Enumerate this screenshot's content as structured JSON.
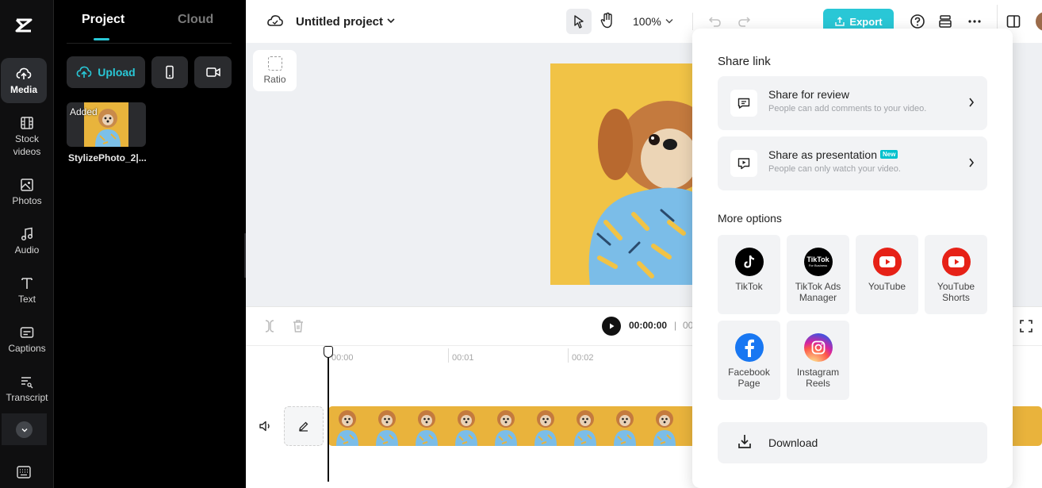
{
  "rail": {
    "items": [
      {
        "label": "Media",
        "icon": "cloud-upload-icon"
      },
      {
        "label": "Stock\nvideos",
        "icon": "film-icon"
      },
      {
        "label": "Photos",
        "icon": "image-icon"
      },
      {
        "label": "Audio",
        "icon": "music-icon"
      },
      {
        "label": "Text",
        "icon": "text-icon"
      },
      {
        "label": "Captions",
        "icon": "captions-icon"
      },
      {
        "label": "Transcript",
        "icon": "transcript-icon"
      }
    ]
  },
  "panel": {
    "tabs": [
      "Project",
      "Cloud"
    ],
    "upload_label": "Upload",
    "media": {
      "badge": "Added",
      "name": "StylizePhoto_2|..."
    }
  },
  "topbar": {
    "project_name": "Untitled project",
    "zoom": "100%",
    "export_label": "Export"
  },
  "canvas": {
    "ratio_label": "Ratio"
  },
  "timeline": {
    "time": "00:00:00",
    "separator": "|",
    "duration_partial": "00",
    "ticks": [
      "00:00",
      "00:01",
      "00:02"
    ]
  },
  "share": {
    "heading": "Share link",
    "review_title": "Share for review",
    "review_sub": "People can add comments to your video.",
    "presentation_title": "Share as presentation",
    "new_badge": "New",
    "presentation_sub": "People can only watch your video.",
    "more_heading": "More options",
    "options": [
      "TikTok",
      "TikTok Ads\nManager",
      "YouTube",
      "YouTube\nShorts",
      "Facebook\nPage",
      "Instagram\nReels"
    ],
    "tiktok_ads_logo_text": "TikTok",
    "tiktok_ads_logo_sub": "For Business",
    "download_label": "Download"
  },
  "colors": {
    "accent": "#29c7d6",
    "youtube": "#e62117",
    "facebook": "#1877f2"
  }
}
